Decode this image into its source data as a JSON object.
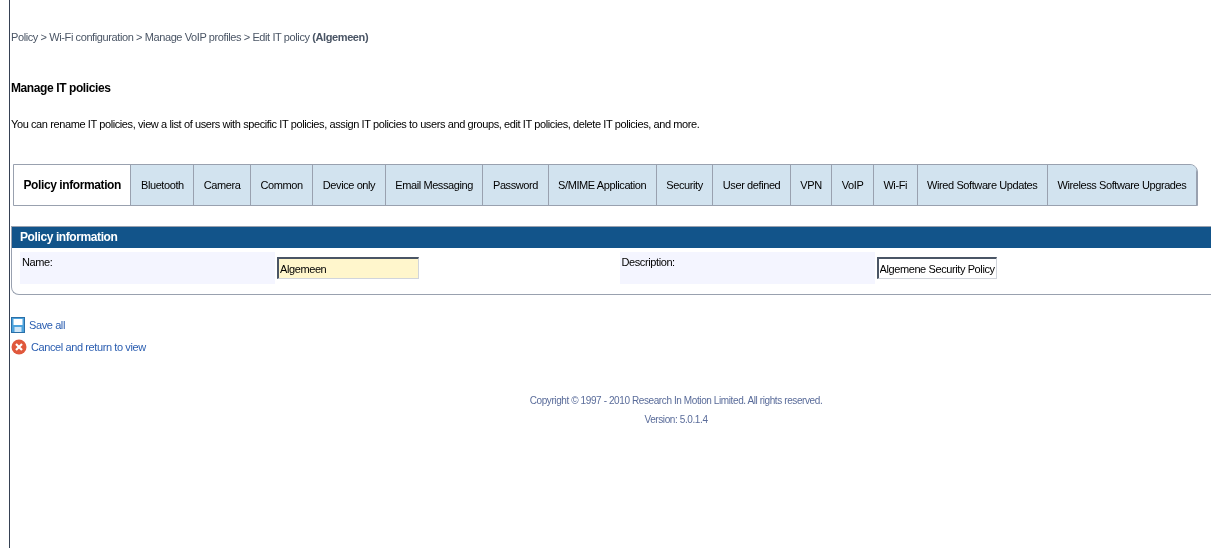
{
  "breadcrumb": "Policy > Wi-Fi configuration > Manage VoIP profiles > Edit IT policy **(Algemeen)**",
  "heading": "Manage IT policies",
  "intro": "You can rename IT policies, view a list of users with specific IT policies, assign IT policies to users and groups, edit IT policies, delete IT policies, and more.",
  "tabs": [
    {
      "label": "Policy information",
      "selected": true
    },
    {
      "label": "Bluetooth",
      "selected": false
    },
    {
      "label": "Camera",
      "selected": false
    },
    {
      "label": "Common",
      "selected": false
    },
    {
      "label": "Device only",
      "selected": false
    },
    {
      "label": "Email Messaging",
      "selected": false
    },
    {
      "label": "Password",
      "selected": false
    },
    {
      "label": "S/MIME Application",
      "selected": false
    },
    {
      "label": "Security",
      "selected": false
    },
    {
      "label": "User defined",
      "selected": false
    },
    {
      "label": "VPN",
      "selected": false
    },
    {
      "label": "VoIP",
      "selected": false
    },
    {
      "label": "Wi-Fi",
      "selected": false
    },
    {
      "label": "Wired Software Updates",
      "selected": false
    },
    {
      "label": "Wireless Software Upgrades",
      "selected": false
    }
  ],
  "panel": {
    "title": "Policy information",
    "fields": [
      {
        "label": "Name:",
        "value": "Algemeen",
        "focused": true
      },
      {
        "label": "Description:",
        "value": "Algemene Security Policy",
        "focused": false
      }
    ]
  },
  "actions": [
    {
      "kind": "save",
      "label": "Save all"
    },
    {
      "kind": "cancel",
      "label": "Cancel and return to view"
    }
  ],
  "footer": {
    "copyright": "Copyright © 1997 - 2010 Research In Motion Limited. All rights reserved.",
    "version": "Version: 5.0.1.4"
  }
}
